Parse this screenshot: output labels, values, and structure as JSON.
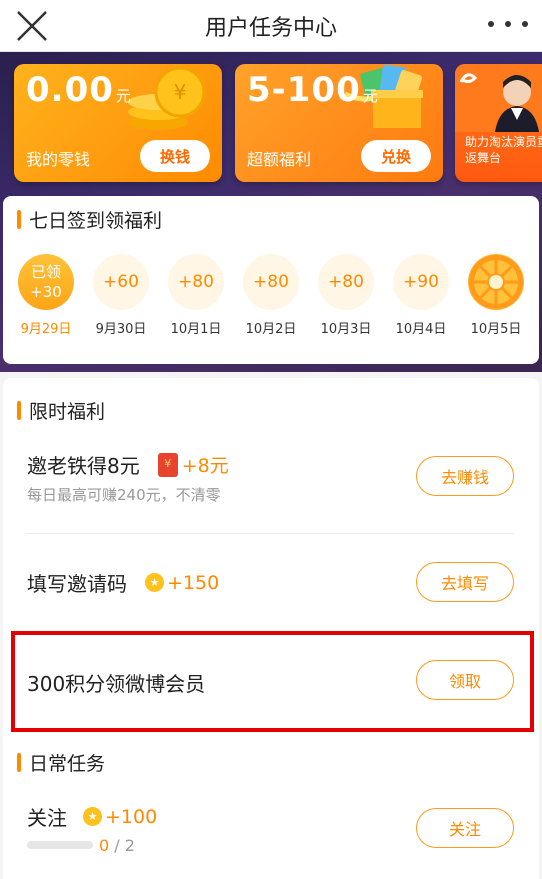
{
  "header": {
    "title": "用户任务中心"
  },
  "cards": {
    "money": {
      "amount": "0.00",
      "unit": "元",
      "label": "我的零钱",
      "button": "换钱"
    },
    "bonus": {
      "amount": "5-100",
      "unit": "元",
      "label": "超额福利",
      "button": "兑换"
    },
    "promo": {
      "text": "助力淘汰演员重返舞台"
    }
  },
  "signin": {
    "title": "七日签到领福利",
    "days": [
      {
        "reward": "已领",
        "reward2": "+30",
        "date": "9月29日"
      },
      {
        "reward": "+60",
        "date": "9月30日"
      },
      {
        "reward": "+80",
        "date": "10月1日"
      },
      {
        "reward": "+80",
        "date": "10月2日"
      },
      {
        "reward": "+80",
        "date": "10月3日"
      },
      {
        "reward": "+90",
        "date": "10月4日"
      },
      {
        "reward": "",
        "date": "10月5日"
      }
    ]
  },
  "limited": {
    "title": "限时福利",
    "tasks": [
      {
        "name": "邀老铁得8元",
        "reward": "+8元",
        "sub": "每日最高可赚240元，不清零",
        "button": "去赚钱"
      },
      {
        "name": "填写邀请码",
        "reward": "+150",
        "button": "去填写"
      },
      {
        "name": "300积分领微博会员",
        "button": "领取"
      }
    ]
  },
  "daily": {
    "title": "日常任务",
    "tasks": [
      {
        "name": "关注",
        "reward": "+100",
        "progress_current": "0",
        "progress_total": "/ 2",
        "progress_fraction": 0,
        "button": "关注"
      }
    ]
  },
  "colors": {
    "accent": "#ff8a00",
    "highlight": "#e50000"
  }
}
